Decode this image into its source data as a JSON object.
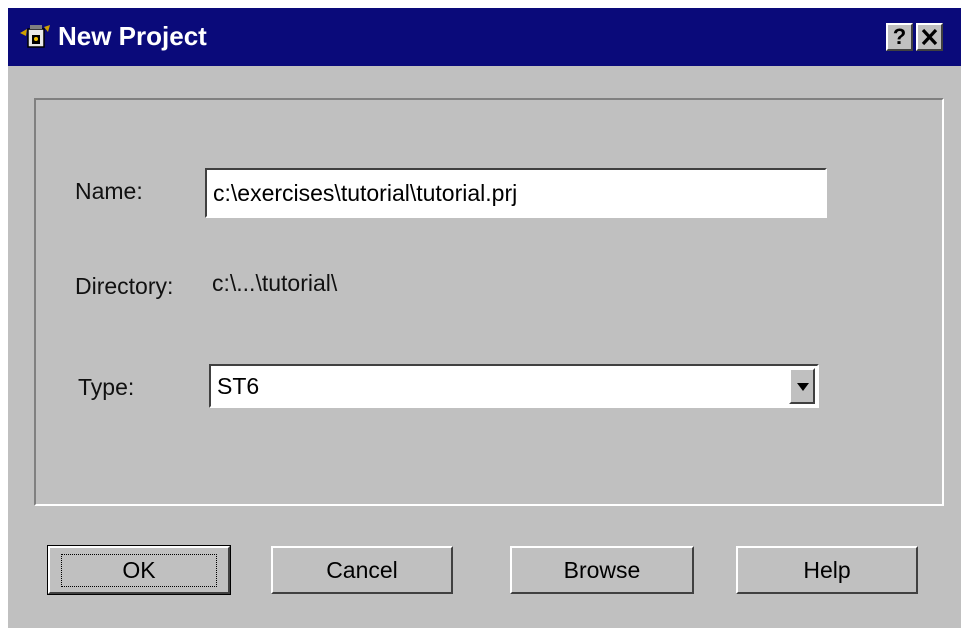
{
  "window": {
    "title": "New Project",
    "help_label": "?",
    "close_label": "✕",
    "icon": "project-app-icon"
  },
  "form": {
    "name_label": "Name:",
    "name_value": "c:\\exercises\\tutorial\\tutorial.prj",
    "directory_label": "Directory:",
    "directory_value": "c:\\...\\tutorial\\",
    "type_label": "Type:",
    "type_value": "ST6"
  },
  "buttons": {
    "ok": "OK",
    "cancel": "Cancel",
    "browse": "Browse",
    "help": "Help"
  },
  "colors": {
    "titlebar": "#0a0a7a",
    "face": "#c0c0c0"
  }
}
